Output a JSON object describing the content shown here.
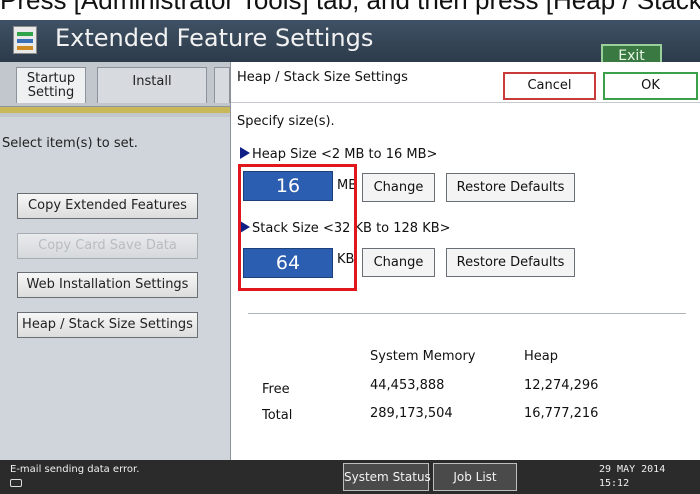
{
  "caption": "Press [Administrator Tools] tab, and then press [Heap / Stack Size Settings].",
  "window": {
    "title": "Extended Feature Settings",
    "exit_label": "Exit",
    "icon": "extended-feature-icon"
  },
  "left_panel": {
    "tabs": [
      {
        "label": "Startup Setting"
      },
      {
        "label": "Install"
      }
    ],
    "instruction": "Select item(s) to set.",
    "menu": [
      {
        "label": "Copy Extended Features",
        "disabled": false
      },
      {
        "label": "Copy Card Save Data",
        "disabled": true
      },
      {
        "label": "Web Installation Settings",
        "disabled": false
      },
      {
        "label": "Heap / Stack Size Settings",
        "disabled": false
      }
    ]
  },
  "dialog": {
    "title": "Heap / Stack Size Settings",
    "cancel_label": "Cancel",
    "ok_label": "OK",
    "instruction": "Specify size(s).",
    "heap": {
      "range_label": "Heap Size <2 MB to 16 MB>",
      "value": "16",
      "unit": "MB",
      "change_label": "Change",
      "restore_label": "Restore Defaults"
    },
    "stack": {
      "range_label": "Stack Size <32 KB to 128 KB>",
      "value": "64",
      "unit": "KB",
      "change_label": "Change",
      "restore_label": "Restore Defaults"
    },
    "memory_table": {
      "headers": [
        "System Memory",
        "Heap"
      ],
      "rows": [
        {
          "label": "Free",
          "system_memory": "44,453,888",
          "heap": "12,274,296"
        },
        {
          "label": "Total",
          "system_memory": "289,173,504",
          "heap": "16,777,216"
        }
      ]
    }
  },
  "status_bar": {
    "message": "E-mail sending data error.",
    "system_status_label": "System Status",
    "job_list_label": "Job List",
    "date": "29 MAY  2014",
    "time": "15:12"
  },
  "colors": {
    "title_bar": "#34465a",
    "value_box": "#2b5db0",
    "highlight": "#e0171c",
    "cancel_border": "#c93a3a",
    "ok_border": "#3aa04a",
    "exit_button": "#3a7a42"
  }
}
